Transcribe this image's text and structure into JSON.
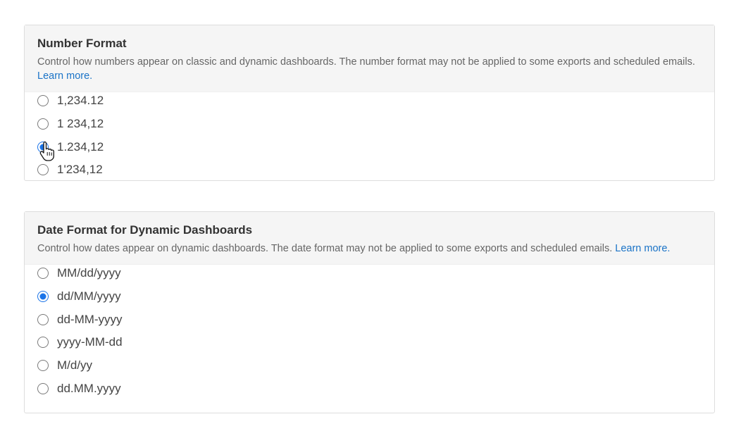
{
  "number_format": {
    "title": "Number Format",
    "description": "Control how numbers appear on classic and dynamic dashboards. The number format may not be applied to some exports and scheduled emails.",
    "learn_more": "Learn more.",
    "options": [
      {
        "label": "1,234.12",
        "selected": false
      },
      {
        "label": "1 234,12",
        "selected": false
      },
      {
        "label": "1.234,12",
        "selected": true
      },
      {
        "label": "1'234,12",
        "selected": false
      }
    ]
  },
  "date_format": {
    "title": "Date Format for Dynamic Dashboards",
    "description": "Control how dates appear on dynamic dashboards. The date format may not be applied to some exports and scheduled emails.",
    "learn_more": "Learn more.",
    "options": [
      {
        "label": "MM/dd/yyyy",
        "selected": false
      },
      {
        "label": "dd/MM/yyyy",
        "selected": true
      },
      {
        "label": "dd-MM-yyyy",
        "selected": false
      },
      {
        "label": "yyyy-MM-dd",
        "selected": false
      },
      {
        "label": "M/d/yy",
        "selected": false
      },
      {
        "label": "dd.MM.yyyy",
        "selected": false
      }
    ]
  },
  "colors": {
    "accent": "#1a73e8",
    "link": "#1a73c7",
    "header_bg": "#f5f5f5",
    "border": "#dddddd"
  },
  "cursor": {
    "icon": "hand-pointer-icon"
  }
}
